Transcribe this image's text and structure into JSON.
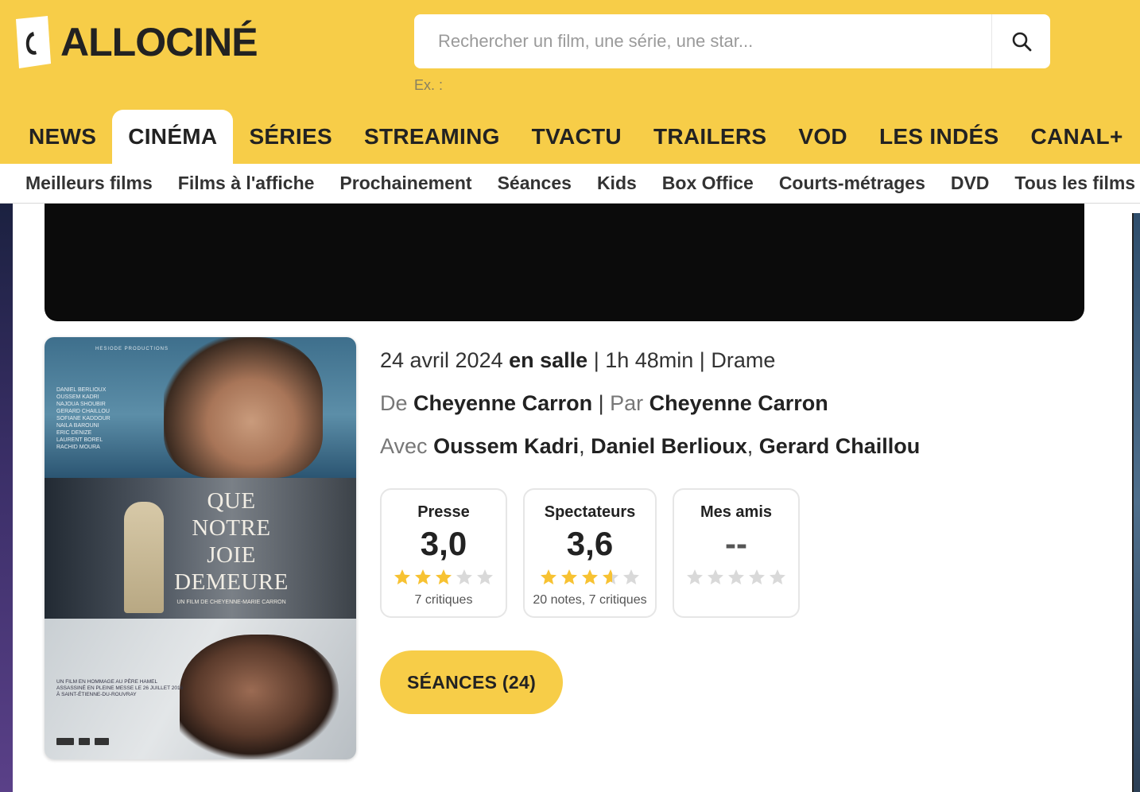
{
  "brand": {
    "name": "ALLOCINÉ",
    "accent": "#f7cd48"
  },
  "search": {
    "placeholder": "Rechercher un film, une série, une star...",
    "hint": "Ex. :"
  },
  "main_nav": [
    {
      "label": "NEWS"
    },
    {
      "label": "CINÉMA",
      "active": true
    },
    {
      "label": "SÉRIES"
    },
    {
      "label": "STREAMING"
    },
    {
      "label": "TVACTU"
    },
    {
      "label": "TRAILERS"
    },
    {
      "label": "VOD"
    },
    {
      "label": "LES INDÉS"
    },
    {
      "label": "CANAL+"
    }
  ],
  "sub_nav": [
    {
      "label": "Meilleurs films"
    },
    {
      "label": "Films à l'affiche"
    },
    {
      "label": "Prochainement"
    },
    {
      "label": "Séances"
    },
    {
      "label": "Kids"
    },
    {
      "label": "Box Office"
    },
    {
      "label": "Courts-métrages"
    },
    {
      "label": "DVD"
    },
    {
      "label": "Tous les films"
    }
  ],
  "movie": {
    "release_date": "24 avril 2024",
    "release_type": "en salle",
    "duration": "1h 48min",
    "genre": "Drame",
    "director_prefix": "De",
    "director": "Cheyenne Carron",
    "writer_prefix": "Par",
    "writer": "Cheyenne Carron",
    "cast_prefix": "Avec",
    "cast": [
      "Oussem Kadri",
      "Daniel Berlioux",
      "Gerard Chaillou"
    ],
    "poster": {
      "production": "HESIODE PRODUCTIONS",
      "credits": "DANIEL BERLIOUX\nOUSSEM KADRI\nNAJOUA SHOUBIR\nGERARD CHAILLOU\nSOFIANE KADDOUR\nNAILA BAROUNI\nERIC DENIZE\nLAURENT BOREL\nRACHID MOURA",
      "title_lines": [
        "QUE",
        "NOTRE",
        "JOIE",
        "DEMEURE"
      ],
      "subtitle": "UN FILM DE CHEYENNE-MARIE CARRON",
      "tribute": "UN FILM EN HOMMAGE AU PÈRE HAMEL\nASSASSINÉ EN PLEINE MESSE LE 26 JUILLET 2016\nÀ SAINT-ÉTIENNE-DU-ROUVRAY"
    }
  },
  "ratings": [
    {
      "title": "Presse",
      "score": "3,0",
      "stars": 3.0,
      "count": "7 critiques"
    },
    {
      "title": "Spectateurs",
      "score": "3,6",
      "stars": 3.6,
      "count": "20 notes, 7 critiques"
    },
    {
      "title": "Mes amis",
      "score": "--",
      "stars": 0,
      "count": ""
    }
  ],
  "colors": {
    "star_filled": "#f7c232",
    "star_empty": "#d9d9d9"
  },
  "cta": {
    "label": "SÉANCES (24)"
  }
}
